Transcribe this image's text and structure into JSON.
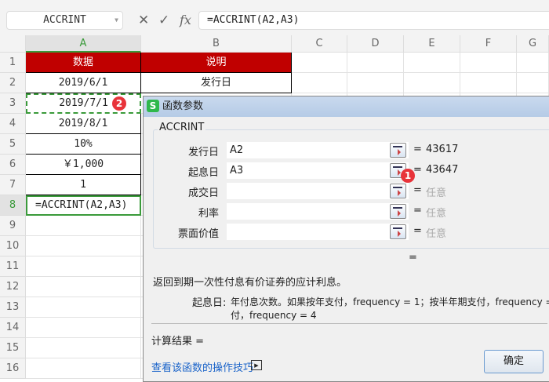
{
  "formula_bar": {
    "name_box": "ACCRINT",
    "cancel_icon": "✕",
    "confirm_icon": "✓",
    "fx_label": "fx",
    "formula": "=ACCRINT(A2,A3)"
  },
  "columns": [
    "A",
    "B",
    "C",
    "D",
    "E",
    "F",
    "G"
  ],
  "rows": [
    "1",
    "2",
    "3",
    "4",
    "5",
    "6",
    "7",
    "8",
    "9",
    "10",
    "11",
    "12",
    "13",
    "14",
    "15",
    "16"
  ],
  "cells": {
    "A": [
      "数据",
      "2019/6/1",
      "2019/7/1",
      "2019/8/1",
      "10%",
      "￥1,000",
      "1",
      "=ACCRINT(A2,A3)"
    ],
    "B": [
      "说明",
      "发行日"
    ]
  },
  "badges": {
    "one": "1",
    "two": "2"
  },
  "dialog": {
    "title": "函数参数",
    "logo": "S",
    "function_name": "ACCRINT",
    "params": [
      {
        "label": "发行日",
        "value": "A2",
        "result": "43617"
      },
      {
        "label": "起息日",
        "value": "A3",
        "result": "43647"
      },
      {
        "label": "成交日",
        "value": "",
        "result": "任意"
      },
      {
        "label": "利率",
        "value": "",
        "result": "任意"
      },
      {
        "label": "票面价值",
        "value": "",
        "result": "任意"
      }
    ],
    "eq": "=",
    "description": "返回到期一次性付息有价证券的应计利息。",
    "param_help_label": "起息日:",
    "param_help_line1": "年付息次数。如果按年支付，frequency = 1；按半年期支付，frequency =",
    "param_help_line2": "付，frequency = 4",
    "result_label": "计算结果  =",
    "help_link": "查看该函数的操作技巧",
    "ok_button": "确定"
  },
  "colors": {
    "header_red": "#c00000",
    "accent_green": "#3a9a3a",
    "badge_red": "#e8333a"
  }
}
